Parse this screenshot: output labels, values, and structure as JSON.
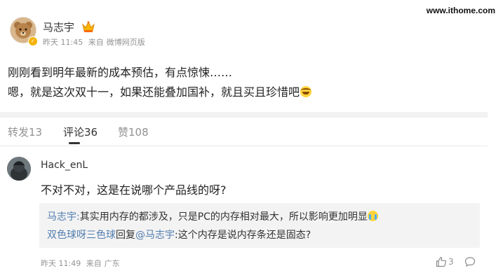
{
  "watermark": "www.ithome.com",
  "post": {
    "author": "马志宇",
    "time": "昨天 11:45",
    "source_prefix": "来自",
    "source": "微博网页版",
    "line1": "刚刚看到明年最新的成本预估，有点惊悚……",
    "line2": "嗯，就是这次双十一，如果还能叠加国补，就且买且珍惜吧"
  },
  "tabs": [
    {
      "label": "转发13"
    },
    {
      "label": "评论36"
    },
    {
      "label": "赞108"
    }
  ],
  "comment": {
    "user": "Hack_enL",
    "text": "不对不对，这是在说哪个产品线的呀?",
    "replies": {
      "r1_user": "马志宇",
      "r1_sep": ":",
      "r1_text": "其实用内存的都涉及，只是PC的内存相对最大，所以影响更加明显",
      "r2_user": "双色球呀三色球",
      "r2_mid": "回复",
      "r2_mention": "@马志宇",
      "r2_sep": ":",
      "r2_text": "这个内存是说内存条还是固态?"
    },
    "time": "昨天 11:49",
    "location_prefix": "来自",
    "location": "广东",
    "likes": "3"
  },
  "colors": {
    "link": "#507daf",
    "muted": "#939393",
    "badge": "#f5b300"
  },
  "icons": [
    "crown-icon",
    "verified-badge-icon",
    "laugh-cry-emoji",
    "cry-emoji",
    "thumbs-up-icon",
    "comment-bubble-icon"
  ]
}
